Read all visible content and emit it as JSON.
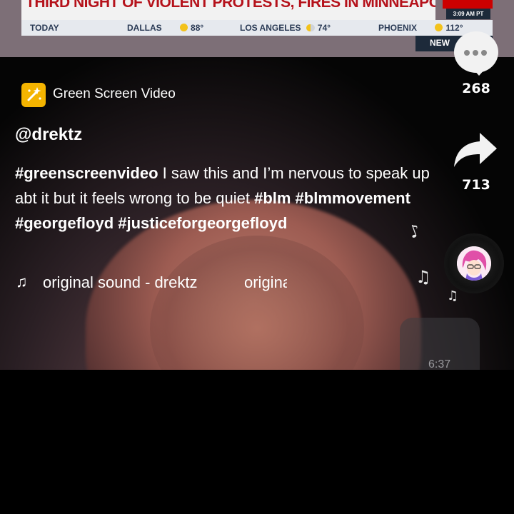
{
  "news": {
    "headline": "THIRD NIGHT OF VIOLENT PROTESTS, FIRES IN MINNEAPOLIS",
    "time": "3:09 AM PT",
    "ticker": {
      "today": "TODAY",
      "cities": [
        {
          "name": "DALLAS",
          "temp": "88°"
        },
        {
          "name": "LOS ANGELES",
          "temp": "74°"
        },
        {
          "name": "PHOENIX",
          "temp": "112°"
        }
      ]
    },
    "bar_label": "NEW"
  },
  "rail": {
    "comments_count": "268",
    "shares_count": "713"
  },
  "effect": {
    "label": "Green Screen Video"
  },
  "post": {
    "username": "@drektz",
    "caption_parts": {
      "tag1": "#greenscreenvideo",
      "text": " I saw this and I’m nervous to speak up abt it but it feels wrong to be quiet ",
      "tags": "#blm #blmmovement #georgefloyd #justiceforgeorgefloyd"
    },
    "sound": "original sound - drektz",
    "sound_repeat": "original sound - drektz"
  },
  "background": {
    "phone_time": "6:37"
  },
  "colors": {
    "headline_red": "#b5121b",
    "effect_icon": "#f4b400",
    "background": "#000000"
  }
}
